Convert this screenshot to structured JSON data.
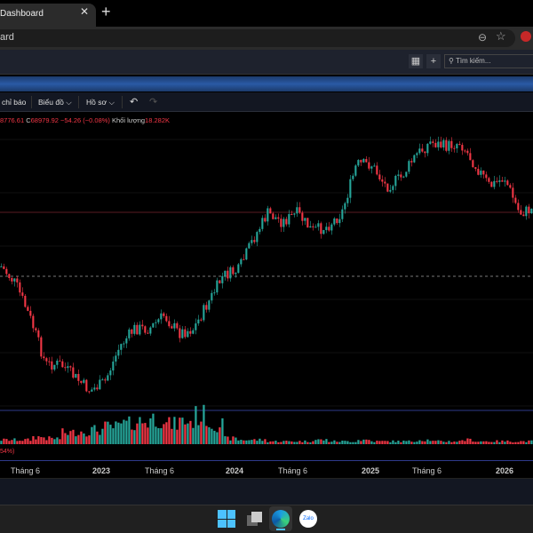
{
  "browser": {
    "tab_title": "Dashboard",
    "address": "ard",
    "close": "✕",
    "new_tab": "+"
  },
  "app": {
    "search_placeholder": "Tìm kiếm...",
    "grid_icon": "▦",
    "add": "+"
  },
  "toolbar": {
    "indicators": "chỉ báo",
    "chart": "Biểu đồ",
    "profile": "Hồ sơ",
    "undo": "↶",
    "redo": "↷",
    "chev": "⌵"
  },
  "legend": {
    "low": "8776.61",
    "close_label": "C",
    "close": "68979.92",
    "change": "−54.26 (−0.08%)",
    "volume_label": "Khối lượng",
    "volume": "18.282K"
  },
  "volume_pct": "54%)",
  "colors": {
    "up": "#26a69a",
    "down": "#f23645",
    "accent": "#2a5aa5"
  },
  "chart_data": {
    "type": "candlestick",
    "x_labels": [
      "Tháng 6",
      "2023",
      "Tháng 6",
      "2024",
      "Tháng 6",
      "2025",
      "Tháng 6",
      "2026"
    ],
    "close_path": [
      300,
      320,
      360,
      410,
      410,
      425,
      440,
      430,
      390,
      370,
      370,
      355,
      375,
      370,
      340,
      310,
      305,
      270,
      240,
      250,
      240,
      260,
      255,
      240,
      185,
      185,
      210,
      200,
      175,
      160,
      165,
      160,
      185,
      210,
      200,
      240,
      235
    ],
    "price_note": "relative index values (inverted scale), price axis not visible",
    "volume_profile": [
      3,
      3,
      5,
      4,
      8,
      9,
      10,
      12,
      14,
      16,
      18,
      14,
      16,
      20,
      14,
      4,
      3,
      3,
      2,
      2,
      2,
      3,
      2,
      2,
      3,
      2,
      2,
      2,
      3,
      2,
      2,
      3,
      2,
      2,
      2,
      2,
      2
    ]
  },
  "taskbar": {
    "zalo": "Zalo"
  }
}
